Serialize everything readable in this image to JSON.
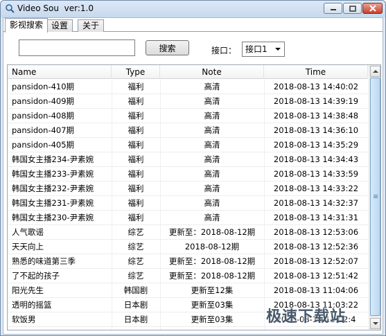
{
  "window": {
    "title": "Video Sou  ver:1.0"
  },
  "tabs": [
    {
      "label": "影视搜索",
      "active": true
    },
    {
      "label": "设置",
      "active": false
    },
    {
      "label": "关于",
      "active": false
    }
  ],
  "search": {
    "value": "",
    "button_label": "搜索"
  },
  "interface": {
    "label": "接口：",
    "selected": "接口1"
  },
  "table": {
    "columns": [
      "Name",
      "Type",
      "Note",
      "Time"
    ],
    "rows": [
      {
        "name": "pansidon-410期",
        "type": "福利",
        "note": "高清",
        "time": "2018-08-13 14:40:02"
      },
      {
        "name": "pansidon-409期",
        "type": "福利",
        "note": "高清",
        "time": "2018-08-13 14:39:19"
      },
      {
        "name": "pansidon-408期",
        "type": "福利",
        "note": "高清",
        "time": "2018-08-13 14:38:48"
      },
      {
        "name": "pansidon-407期",
        "type": "福利",
        "note": "高清",
        "time": "2018-08-13 14:36:10"
      },
      {
        "name": "pansidon-405期",
        "type": "福利",
        "note": "高清",
        "time": "2018-08-13 14:35:29"
      },
      {
        "name": "韩国女主播234-尹素婉",
        "type": "福利",
        "note": "高清",
        "time": "2018-08-13 14:34:43"
      },
      {
        "name": "韩国女主播233-尹素婉",
        "type": "福利",
        "note": "高清",
        "time": "2018-08-13 14:33:59"
      },
      {
        "name": "韩国女主播232-尹素婉",
        "type": "福利",
        "note": "高清",
        "time": "2018-08-13 14:33:22"
      },
      {
        "name": "韩国女主播231-尹素婉",
        "type": "福利",
        "note": "高清",
        "time": "2018-08-13 14:32:37"
      },
      {
        "name": "韩国女主播230-尹素婉",
        "type": "福利",
        "note": "高清",
        "time": "2018-08-13 14:31:31"
      },
      {
        "name": "人气歌谣",
        "type": "综艺",
        "note": "更新至：2018-08-12期",
        "time": "2018-08-13 12:53:06"
      },
      {
        "name": "天天向上",
        "type": "综艺",
        "note": "2018-08-12期",
        "time": "2018-08-13 12:52:36"
      },
      {
        "name": "熟悉的味道第三季",
        "type": "综艺",
        "note": "更新至：2018-08-12期",
        "time": "2018-08-13 12:52:07"
      },
      {
        "name": " 了不起的孩子",
        "type": "综艺",
        "note": "更新至：2018-08-12期",
        "time": "2018-08-13 12:51:42"
      },
      {
        "name": "阳光先生",
        "type": "韩国剧",
        "note": "更新至12集",
        "time": "2018-08-13 11:04:06"
      },
      {
        "name": "透明的摇篮",
        "type": "日本剧",
        "note": "更新至03集",
        "time": "2018-08-13 11:03:22"
      },
      {
        "name": "软饭男",
        "type": "日本剧",
        "note": "更新至03集",
        "time": "2018-08-13 11:02:4"
      }
    ]
  },
  "watermark": "极速下载站",
  "colors": {
    "titlebar": "#c7d9ee",
    "close_button": "#c7412c",
    "scroll_thumb": "#b9d9f3"
  }
}
